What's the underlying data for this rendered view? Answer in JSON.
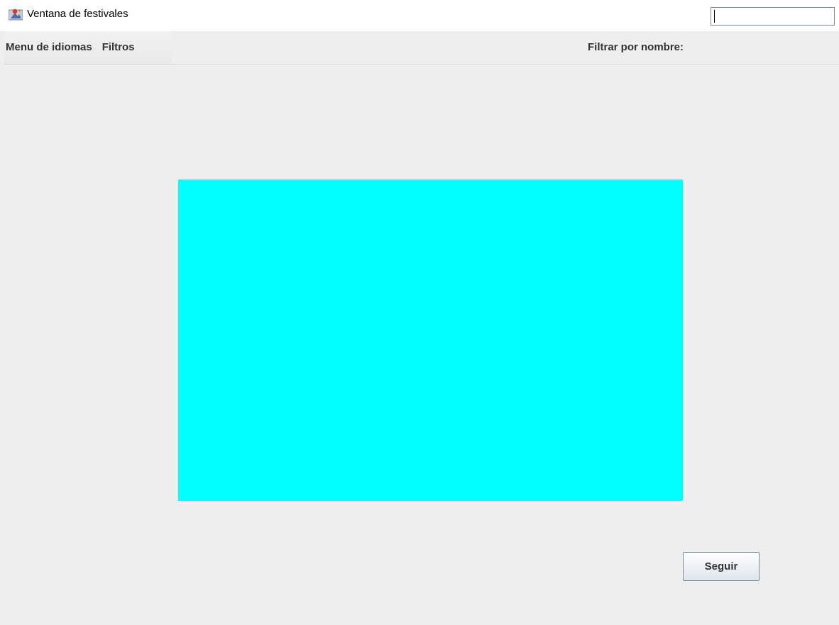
{
  "window": {
    "title": "Ventana de festivales",
    "controls": [
      "minimize-icon",
      "maximize-icon",
      "close-icon"
    ]
  },
  "menubar": {
    "items": [
      {
        "label": "Menu de idiomas"
      },
      {
        "label": "Filtros"
      }
    ],
    "filter": {
      "label": "Filtrar por nombre:",
      "value": "",
      "placeholder": ""
    }
  },
  "content": {
    "panel_color": "#00ffff",
    "continue_label": "Seguir"
  }
}
